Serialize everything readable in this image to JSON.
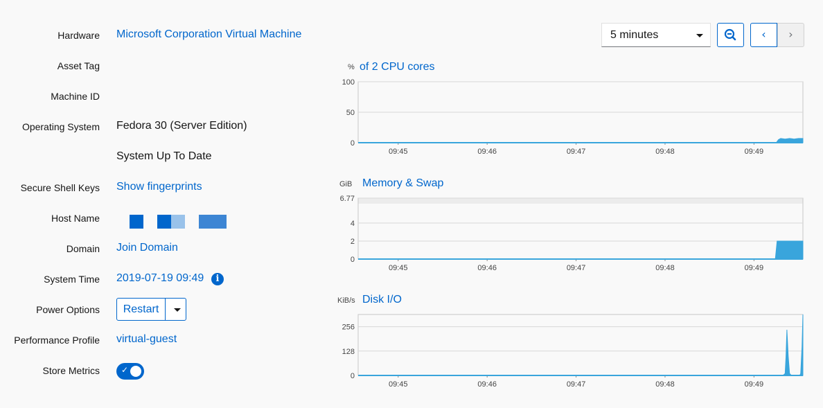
{
  "details": {
    "hardware": {
      "label": "Hardware",
      "value": "Microsoft Corporation Virtual Machine"
    },
    "asset_tag": {
      "label": "Asset Tag"
    },
    "machine_id": {
      "label": "Machine ID"
    },
    "os": {
      "label": "Operating System",
      "value": "Fedora 30 (Server Edition)",
      "update_status": "System Up To Date"
    },
    "ssh": {
      "label": "Secure Shell Keys",
      "value": "Show fingerprints"
    },
    "host_name": {
      "label": "Host Name"
    },
    "domain": {
      "label": "Domain",
      "value": "Join Domain"
    },
    "system_time": {
      "label": "System Time",
      "value": "2019-07-19 09:49",
      "info_icon": "info-circle-icon"
    },
    "power": {
      "label": "Power Options",
      "button": "Restart"
    },
    "performance_profile": {
      "label": "Performance Profile",
      "value": "virtual-guest"
    },
    "store_metrics": {
      "label": "Store Metrics",
      "enabled": true
    }
  },
  "toolbar": {
    "range": "5 minutes",
    "zoom_icon": "zoom-out-icon",
    "prev_icon": "chevron-left-icon",
    "next_icon": "chevron-right-icon"
  },
  "colors": {
    "accent": "#0066cc",
    "plot": "#39a5dc"
  },
  "chart_data": [
    {
      "type": "area",
      "unit": "%",
      "title": "of 2 CPU cores",
      "yticks": [
        "100",
        "50",
        "0"
      ],
      "ylim": [
        0,
        100
      ],
      "xticks": [
        "09:45",
        "09:46",
        "09:47",
        "09:48",
        "09:49"
      ],
      "x": [
        0,
        0.94,
        0.945,
        0.95,
        0.96,
        0.97,
        0.98,
        0.99,
        1.0
      ],
      "values": [
        0,
        0,
        5,
        7,
        6,
        7,
        6,
        7,
        7
      ]
    },
    {
      "type": "area",
      "unit": "GiB",
      "title": "Memory & Swap",
      "yticks": [
        "6.77",
        "4",
        "2",
        "0"
      ],
      "ylim": [
        0,
        6.77
      ],
      "xticks": [
        "09:45",
        "09:46",
        "09:47",
        "09:48",
        "09:49"
      ],
      "x": [
        0,
        0.938,
        0.942,
        1.0
      ],
      "values": [
        0,
        0,
        2.0,
        2.0
      ]
    },
    {
      "type": "area",
      "unit": "KiB/s",
      "title": "Disk I/O",
      "yticks": [
        "256",
        "128",
        "0"
      ],
      "ylim": [
        0,
        320
      ],
      "xticks": [
        "09:45",
        "09:46",
        "09:47",
        "09:48",
        "09:49"
      ],
      "x": [
        0,
        0.955,
        0.96,
        0.962,
        0.964,
        0.967,
        0.97,
        0.972,
        0.975,
        0.993,
        0.995,
        0.998,
        1.0
      ],
      "values": [
        0,
        0,
        10,
        100,
        240,
        100,
        10,
        5,
        0,
        0,
        10,
        150,
        320
      ]
    }
  ]
}
